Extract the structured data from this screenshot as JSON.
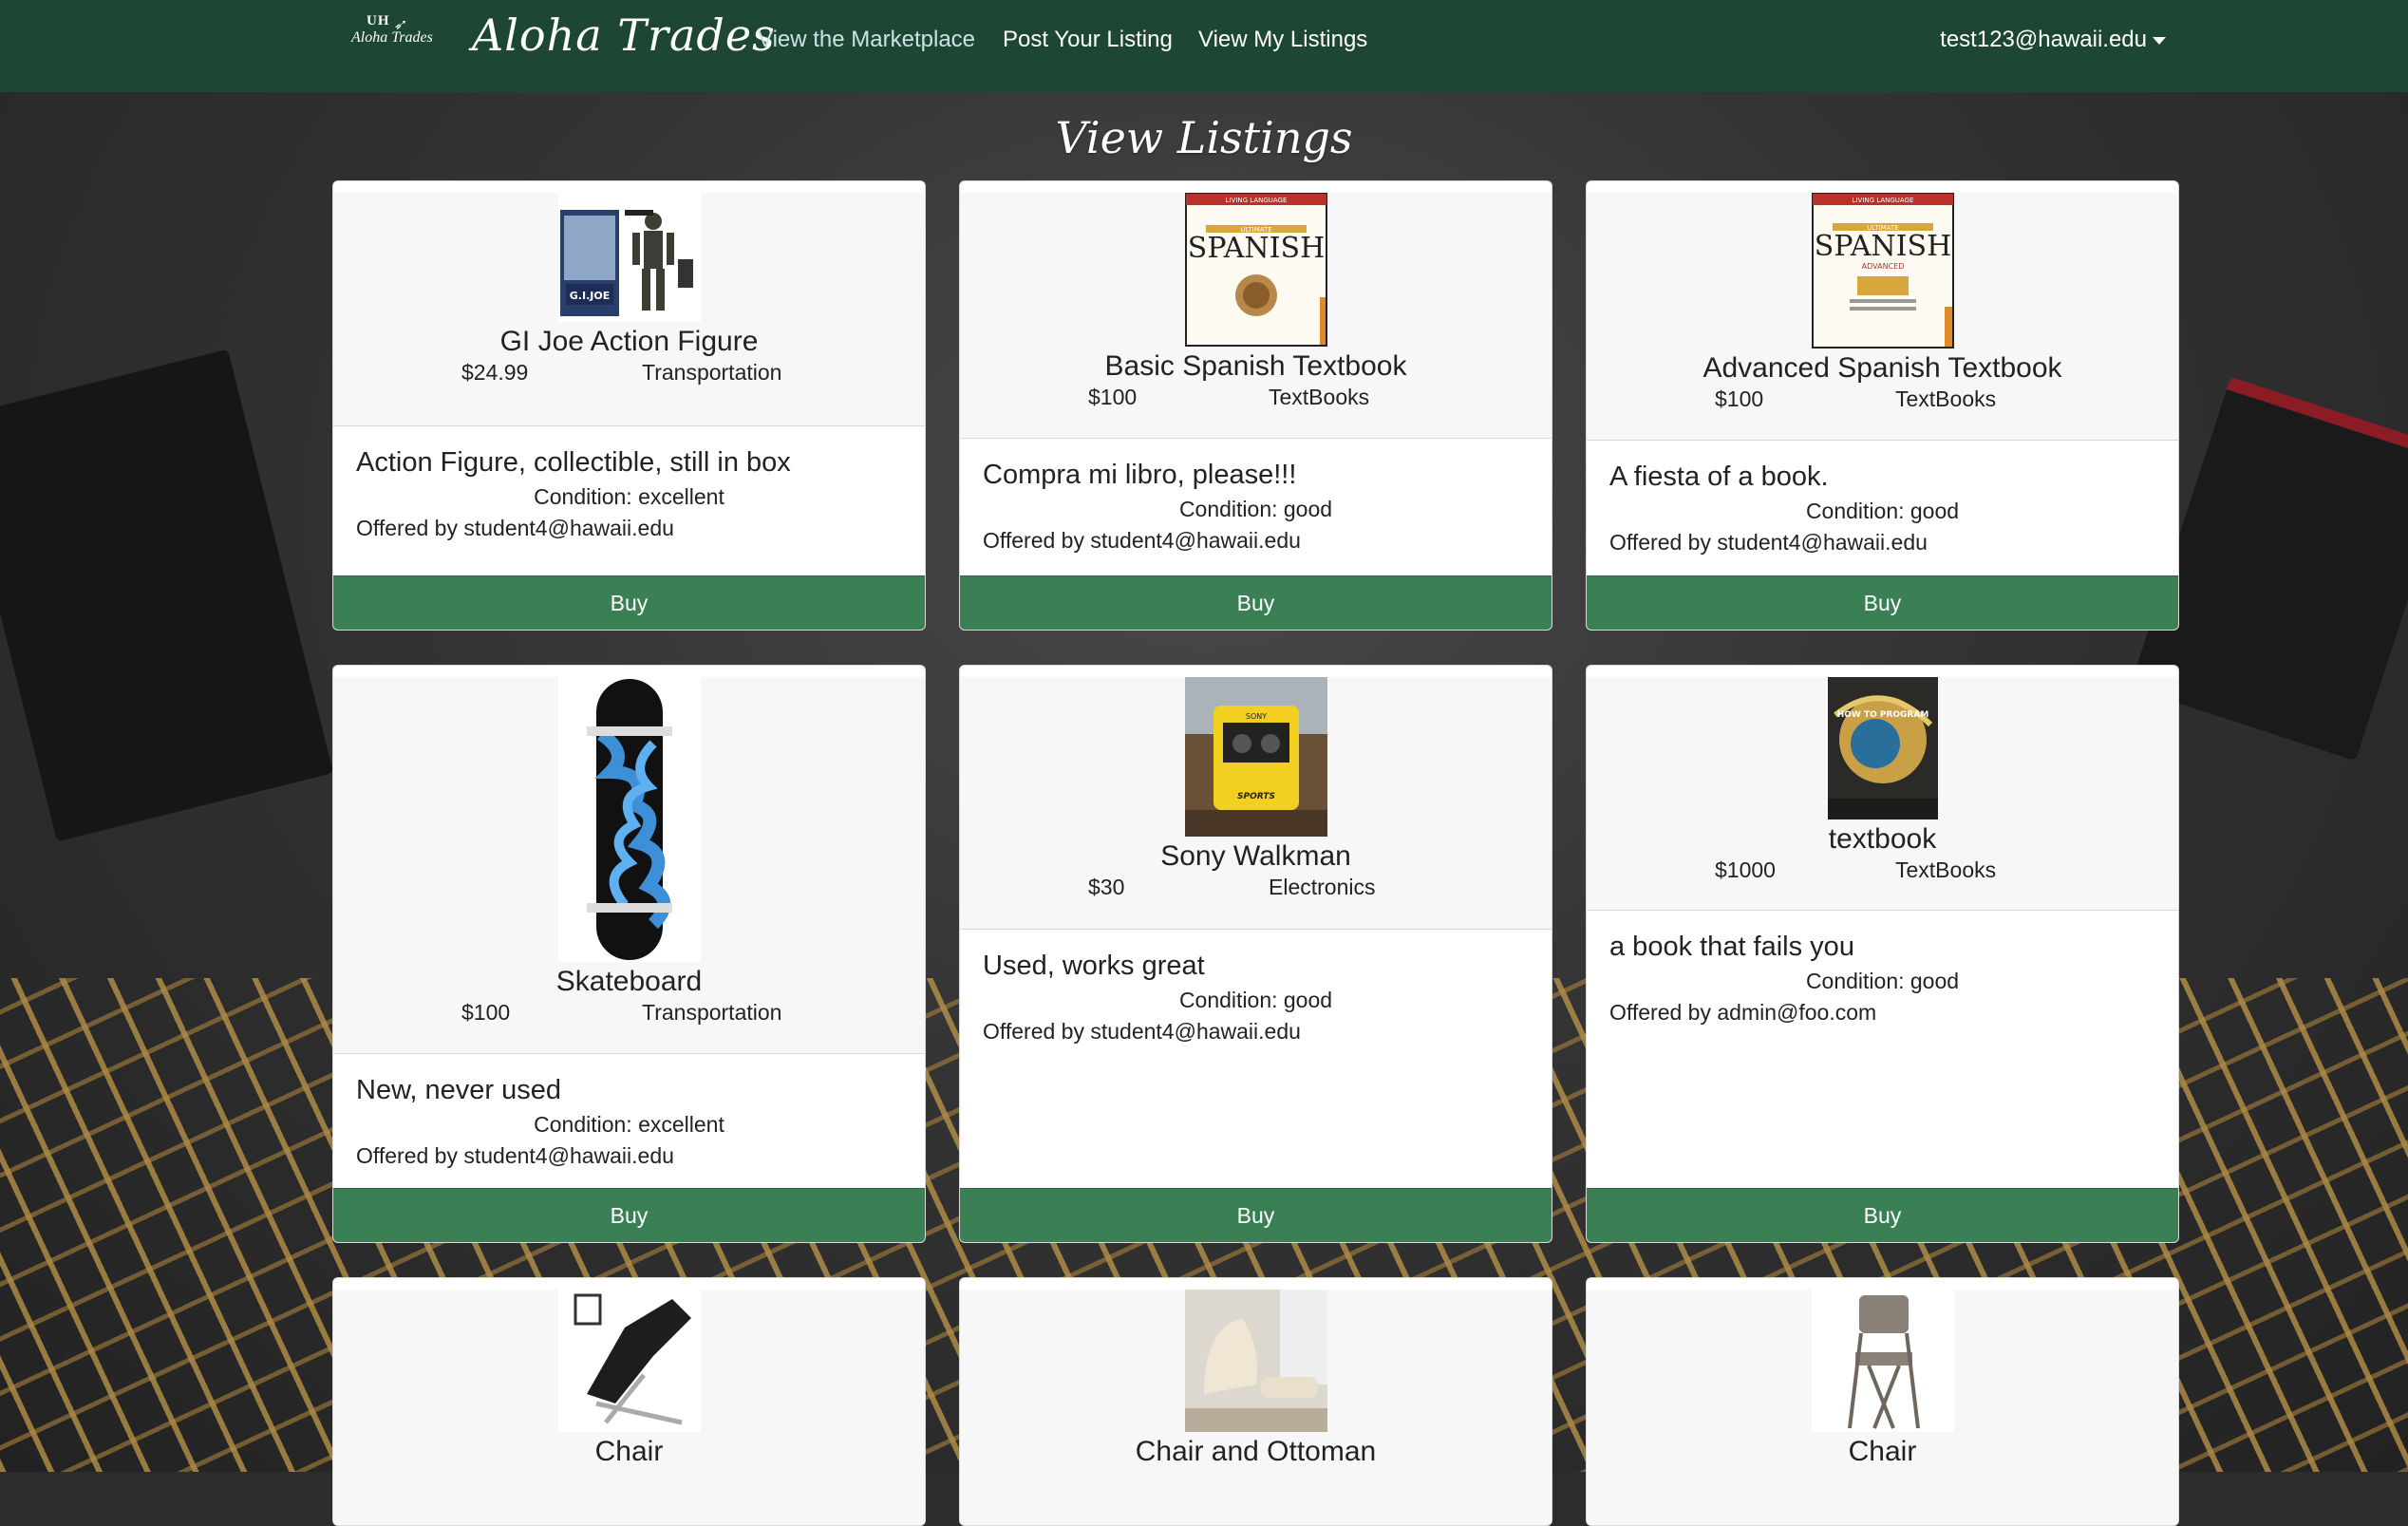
{
  "brand": {
    "logo_text": "UH",
    "logo_sub": "Aloha Trades",
    "title": "Aloha Trades"
  },
  "nav": {
    "links": [
      "View the Marketplace",
      "Post Your Listing",
      "View My Listings"
    ],
    "user": "test123@hawaii.edu"
  },
  "page": {
    "title": "View Listings"
  },
  "buy_label": "Buy",
  "listings": [
    {
      "name": "GI Joe Action Figure",
      "price": "$24.99",
      "category": "Transportation",
      "description": "Action Figure, collectible, still in box",
      "condition": "Condition: excellent",
      "offered_by": "Offered by student4@hawaii.edu",
      "image": "action-figure"
    },
    {
      "name": "Basic Spanish Textbook",
      "price": "$100",
      "category": "TextBooks",
      "description": "Compra mi libro, please!!!",
      "condition": "Condition: good",
      "offered_by": "Offered by student4@hawaii.edu",
      "image": "spanish-book"
    },
    {
      "name": "Advanced Spanish Textbook",
      "price": "$100",
      "category": "TextBooks",
      "description": "A fiesta of a book.",
      "condition": "Condition: good",
      "offered_by": "Offered by student4@hawaii.edu",
      "image": "spanish-book-advanced"
    },
    {
      "name": "Skateboard",
      "price": "$100",
      "category": "Transportation",
      "description": "New, never used",
      "condition": "Condition: excellent",
      "offered_by": "Offered by student4@hawaii.edu",
      "image": "skateboard"
    },
    {
      "name": "Sony Walkman",
      "price": "$30",
      "category": "Electronics",
      "description": "Used, works great",
      "condition": "Condition: good",
      "offered_by": "Offered by student4@hawaii.edu",
      "image": "walkman"
    },
    {
      "name": "textbook",
      "price": "$1000",
      "category": "TextBooks",
      "description": "a book that fails you",
      "condition": "Condition: good",
      "offered_by": "Offered by admin@foo.com",
      "image": "programming-book"
    },
    {
      "name": "Chair",
      "image": "recliner-chair"
    },
    {
      "name": "Chair and Ottoman",
      "image": "lounge-chair"
    },
    {
      "name": "Chair",
      "image": "folding-chair"
    }
  ],
  "book_covers": {
    "basic": {
      "series": "LIVING LANGUAGE",
      "edition": "ULTIMATE",
      "title": "SPANISH"
    },
    "advanced": {
      "series": "LIVING LANGUAGE",
      "edition": "ULTIMATE",
      "title": "SPANISH",
      "level": "ADVANCED"
    },
    "programming": {
      "title": "HOW TO PROGRAM"
    },
    "toy_brand": "G.I.JOE",
    "walkman_brand": "SONY",
    "walkman_line": "SPORTS"
  },
  "colors": {
    "navbar": "#1d4733",
    "buy_button": "#3b7f55"
  }
}
